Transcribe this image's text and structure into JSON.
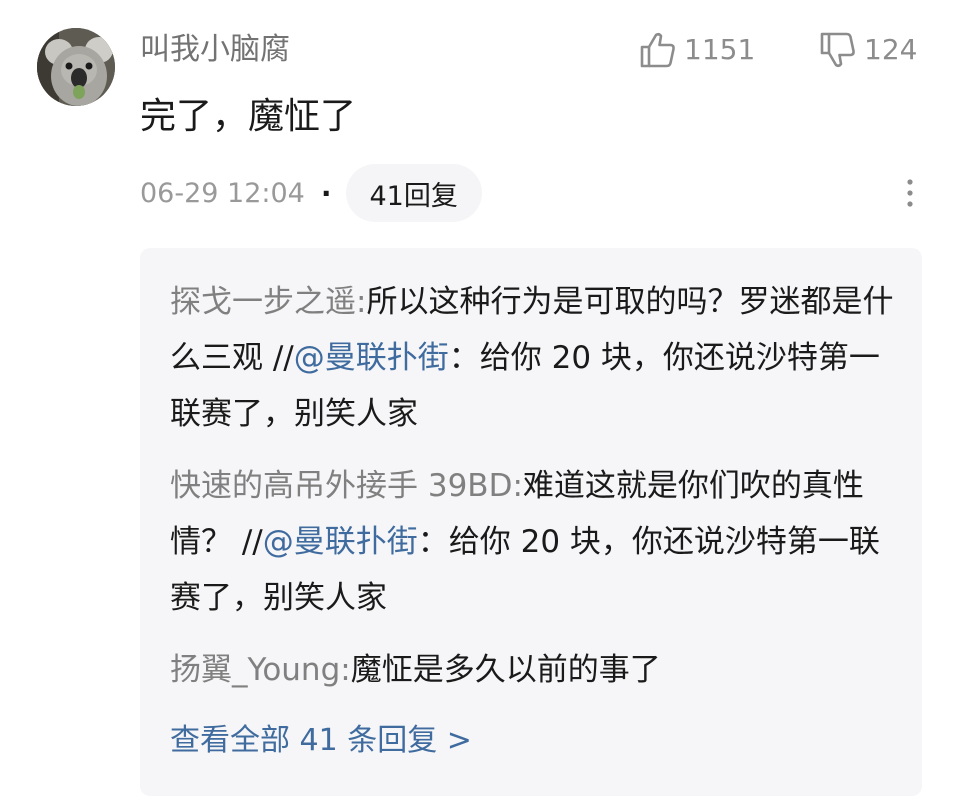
{
  "comment": {
    "username": "叫我小脑腐",
    "avatar_icon": "koala-avatar",
    "content": "完了，魔怔了",
    "likes": "1151",
    "dislikes": "124",
    "timestamp": "06-29 12:04",
    "separator": "·",
    "reply_count_label": "41回复"
  },
  "replies": [
    {
      "author": "探戈一步之遥",
      "colon": ":",
      "text": "所以这种行为是可取的吗？罗迷都是什么三观 //",
      "mention": "@曼联扑街",
      "quote": "：给你 20 块，你还说沙特第一联赛了，别笑人家"
    },
    {
      "author": "快速的高吊外接手 39BD",
      "colon": ":",
      "text": "难道这就是你们吹的真性情？ //",
      "mention": "@曼联扑街",
      "quote": "：给你 20 块，你还说沙特第一联赛了，别笑人家"
    },
    {
      "author": "扬翼_Young",
      "colon": ":",
      "text": "魔怔是多久以前的事了"
    }
  ],
  "view_all_label": "查看全部 41 条回复 >",
  "colors": {
    "link": "#3f6b9e",
    "muted": "#999999",
    "reply_bg": "#f6f6f8"
  }
}
